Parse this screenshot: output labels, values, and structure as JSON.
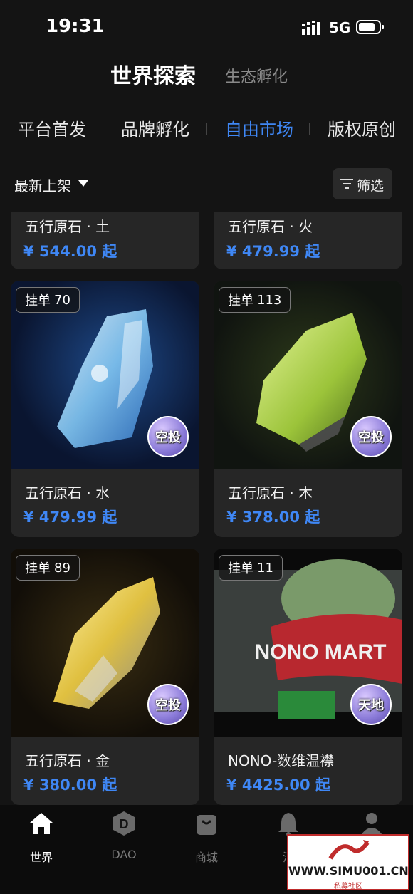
{
  "status_bar": {
    "time": "19:31",
    "network": "5G"
  },
  "top_tabs": {
    "main": "世界探索",
    "secondary": "生态孵化"
  },
  "category_tabs": [
    {
      "label": "平台首发",
      "active": false
    },
    {
      "label": "品牌孵化",
      "active": false
    },
    {
      "label": "自由市场",
      "active": true
    },
    {
      "label": "版权原创",
      "active": false
    }
  ],
  "sort": {
    "label": "最新上架",
    "filter_label": "筛选"
  },
  "cards": [
    {
      "name": "五行原石 · 土",
      "price": "¥ 544.00 起"
    },
    {
      "name": "五行原石 · 火",
      "price": "¥ 479.99 起"
    },
    {
      "name": "五行原石 · 水",
      "price": "¥ 479.99 起",
      "badge_label": "挂单",
      "badge_count": "70",
      "stamp": "空投"
    },
    {
      "name": "五行原石 · 木",
      "price": "¥ 378.00 起",
      "badge_label": "挂单",
      "badge_count": "113",
      "stamp": "空投"
    },
    {
      "name": "五行原石 · 金",
      "price": "¥ 380.00 起",
      "badge_label": "挂单",
      "badge_count": "89",
      "stamp": "空投"
    },
    {
      "name": "NONO-数维温襟",
      "price": "¥ 4425.00 起",
      "badge_label": "挂单",
      "badge_count": "11",
      "stamp": "天地",
      "brand_text": "NONO MART"
    }
  ],
  "bottom_nav": [
    {
      "label": "世界",
      "icon": "home-icon",
      "active": true
    },
    {
      "label": "DAO",
      "icon": "dao-icon",
      "active": false
    },
    {
      "label": "商城",
      "icon": "shopping-bag-icon",
      "active": false
    },
    {
      "label": "消",
      "icon": "bell-icon",
      "active": false
    },
    {
      "label": "",
      "icon": "user-icon",
      "active": false
    }
  ],
  "watermark": {
    "text": "WWW.SIMU001.CN",
    "subtitle": "私募社区"
  },
  "colors": {
    "accent": "#3f87f5",
    "background": "#141414",
    "card": "#262626"
  }
}
